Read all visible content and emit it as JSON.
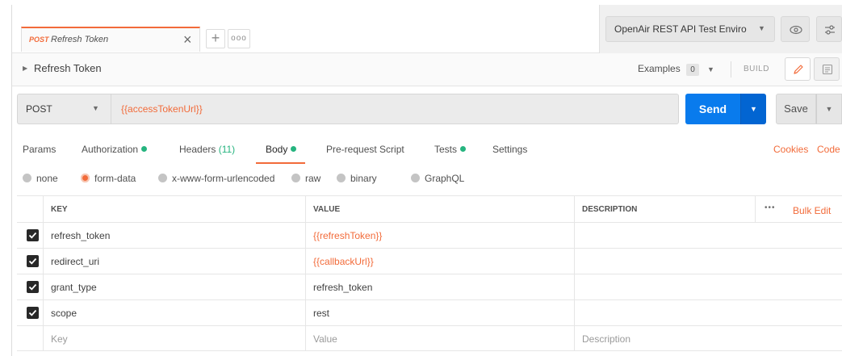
{
  "tab": {
    "method": "POST",
    "title": "Refresh Token",
    "close": "×",
    "add": "+",
    "more": "ooo"
  },
  "environment": {
    "selected": "OpenAir REST API Test Enviro",
    "caret": "▼"
  },
  "request": {
    "name": "Refresh Token",
    "examples_label": "Examples",
    "examples_count": "0",
    "build_label": "BUILD",
    "method": "POST",
    "url": "{{accessTokenUrl}}",
    "send_label": "Send",
    "save_label": "Save"
  },
  "request_tabs": [
    {
      "label": "Params"
    },
    {
      "label": "Authorization",
      "dot": true
    },
    {
      "label": "Headers",
      "count": "(11)"
    },
    {
      "label": "Body",
      "dot": true,
      "active": true
    },
    {
      "label": "Pre-request Script"
    },
    {
      "label": "Tests",
      "dot": true
    },
    {
      "label": "Settings"
    }
  ],
  "links": {
    "cookies": "Cookies",
    "code": "Code"
  },
  "body_types": [
    {
      "label": "none",
      "selected": false
    },
    {
      "label": "form-data",
      "selected": true
    },
    {
      "label": "x-www-form-urlencoded",
      "selected": false
    },
    {
      "label": "raw",
      "selected": false
    },
    {
      "label": "binary",
      "selected": false
    },
    {
      "label": "GraphQL",
      "selected": false
    }
  ],
  "table": {
    "headers": {
      "key": "KEY",
      "value": "VALUE",
      "description": "DESCRIPTION",
      "more": "•••",
      "bulk_edit": "Bulk Edit"
    },
    "rows": [
      {
        "checked": true,
        "key": "refresh_token",
        "value": "{{refreshToken}}",
        "value_is_variable": true
      },
      {
        "checked": true,
        "key": "redirect_uri",
        "value": "{{callbackUrl}}",
        "value_is_variable": true
      },
      {
        "checked": true,
        "key": "grant_type",
        "value": "refresh_token",
        "value_is_variable": false
      },
      {
        "checked": true,
        "key": "scope",
        "value": "rest",
        "value_is_variable": false
      }
    ],
    "placeholder": {
      "key": "Key",
      "value": "Value",
      "description": "Description"
    }
  },
  "colors": {
    "accent": "#f26b3a",
    "send_blue": "#097bed",
    "status_green": "#26b47f"
  }
}
